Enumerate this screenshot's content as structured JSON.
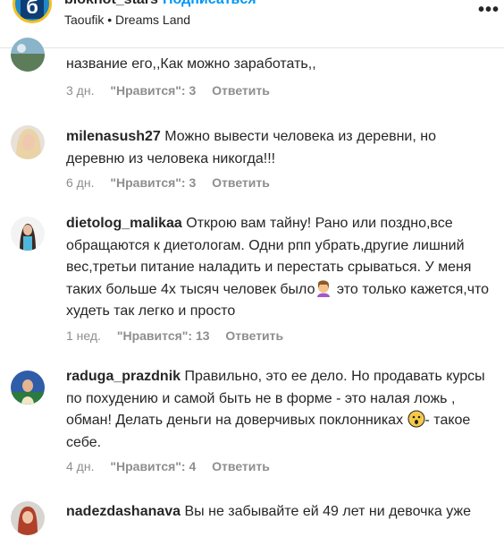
{
  "header": {
    "logo_letter": "б",
    "username": "blokhot_stars",
    "follow": "Подписаться",
    "subtitle": "Taoufik • Dreams Land",
    "more": "•••"
  },
  "comments": [
    {
      "username": "",
      "text": "название его,,Как можно заработать,,",
      "time": "3 дн.",
      "likes": "\"Нравится\": 3",
      "reply": "Ответить"
    },
    {
      "username": "milenasush27",
      "text": " Можно вывести человека из деревни, но деревню из человека никогда!!!",
      "time": "6 дн.",
      "likes": "\"Нравится\": 3",
      "reply": "Ответить"
    },
    {
      "username": "dietolog_malikaa",
      "text_a": " Открою вам тайну! Рано или поздно,все обращаются к диетологам. Одни рпп убрать,другие лишний вес,третьи питание наладить и перестать срываться. У меня таких больше 4х тысяч человек было",
      "text_b": " это только кажется,что худеть так легко и просто",
      "time": "1 нед.",
      "likes": "\"Нравится\": 13",
      "reply": "Ответить"
    },
    {
      "username": "raduga_prazdnik",
      "text_a": " Правильно, это ее дело. Но продавать курсы по похудению и самой быть не в форме - это налая ложь , обман! Делать деньги на доверчивых поклонниках ",
      "text_b": "- такое себе.",
      "time": "4 дн.",
      "likes": "\"Нравится\": 4",
      "reply": "Ответить"
    },
    {
      "username": "nadezdashanava",
      "text": " Вы не забывайте ей 49 лет ни девочка уже"
    }
  ]
}
